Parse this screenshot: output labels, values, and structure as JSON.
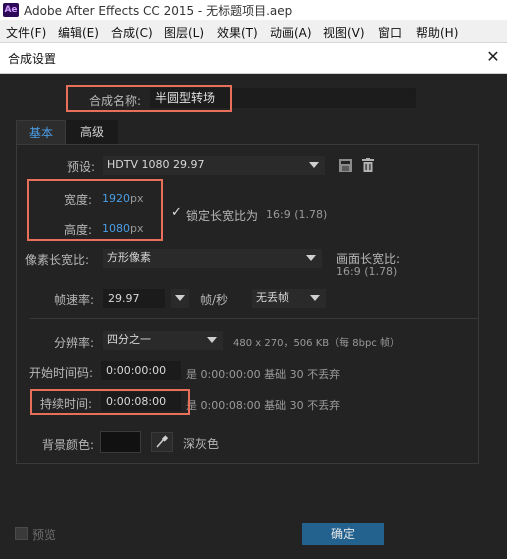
{
  "app": {
    "title": "Adobe After Effects CC 2015 - 无标题项目.aep",
    "logo": "Ae"
  },
  "menu": [
    "文件(F)",
    "编辑(E)",
    "合成(C)",
    "图层(L)",
    "效果(T)",
    "动画(A)",
    "视图(V)",
    "窗口",
    "帮助(H)"
  ],
  "dialog": {
    "title": "合成设置",
    "close": "✕",
    "comp_name_label": "合成名称:",
    "comp_name_value": "半圆型转场",
    "tabs": {
      "basic": "基本",
      "advanced": "高级"
    },
    "preset": {
      "label": "预设:",
      "value": "HDTV 1080 29.97"
    },
    "width": {
      "label": "宽度:",
      "value": "1920",
      "unit": "px"
    },
    "height": {
      "label": "高度:",
      "value": "1080",
      "unit": "px"
    },
    "lock_aspect": {
      "label": "锁定长宽比为",
      "value": "16:9 (1.78)",
      "check": "✓"
    },
    "pixel_aspect": {
      "label": "像素长宽比:",
      "value": "方形像素"
    },
    "frame_aspect": {
      "label": "画面长宽比:",
      "value": "16:9 (1.78)"
    },
    "frame_rate": {
      "label": "帧速率:",
      "value": "29.97",
      "unit": "帧/秒",
      "drop": "无丢帧"
    },
    "resolution": {
      "label": "分辨率:",
      "value": "四分之一",
      "info": "480 x 270，506 KB（每 8bpc 帧）"
    },
    "start_timecode": {
      "label": "开始时间码:",
      "value": "0:00:00:00",
      "note": "是 0:00:00:00  基础 30  不丢弃"
    },
    "duration": {
      "label": "持续时间:",
      "value": "0:00:08:00",
      "note": "是 0:00:08:00  基础 30  不丢弃"
    },
    "bg_color": {
      "label": "背景颜色:",
      "name": "深灰色",
      "color": "#111111"
    },
    "preview_label": "预览",
    "ok_label": "确定"
  },
  "colors": {
    "accent_blue": "#4a9ee6",
    "highlight": "#e8705a",
    "ok_button": "#23628f"
  },
  "icons": [
    "after-effects-logo",
    "close-icon",
    "save-preset-icon",
    "trash-icon",
    "checkmark-icon",
    "eyedropper-icon",
    "chevron-down-icon"
  ]
}
